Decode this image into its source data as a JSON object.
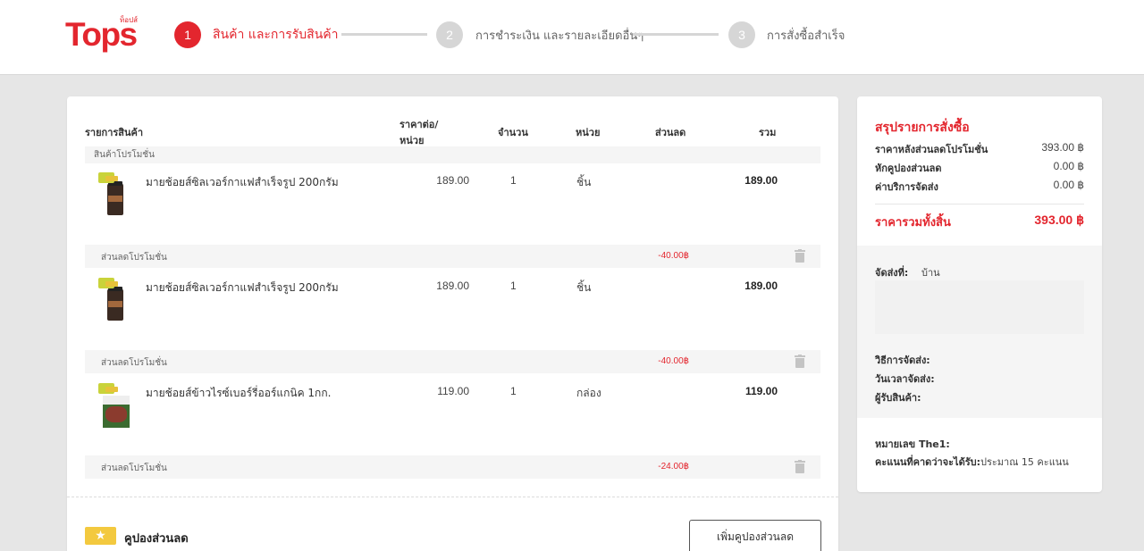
{
  "brand": {
    "logo_text": "Tops",
    "logo_small": "ท็อปส์",
    "accent": "#e3262e"
  },
  "steps": [
    {
      "number": "1",
      "label": "สินค้า และการรับสินค้า",
      "state": "active"
    },
    {
      "number": "2",
      "label": "การชำระเงิน และรายละเอียดอื่นๆ",
      "state": "inactive"
    },
    {
      "number": "3",
      "label": "การสั่งซื้อสำเร็จ",
      "state": "inactive"
    }
  ],
  "cart": {
    "headers": {
      "item": "รายการสินค้า",
      "price_line1": "ราคาต่อ/",
      "price_line2": "หน่วย",
      "qty": "จำนวน",
      "unit": "หน่วย",
      "discount": "ส่วนลด",
      "total": "รวม"
    },
    "promo_section_label": "สินค้าโปรโมชั่น",
    "items": [
      {
        "name": "มายช้อยส์ซิลเวอร์กาแฟสำเร็จรูป 200กรัม",
        "price": "189.00",
        "qty": "1",
        "unit": "ชิ้น",
        "total": "189.00",
        "image_icon": "coffee-jar-icon",
        "discount_label": "ส่วนลดโปรโมชั่น",
        "discount_amount": "-40.00฿"
      },
      {
        "name": "มายช้อยส์ซิลเวอร์กาแฟสำเร็จรูป 200กรัม",
        "price": "189.00",
        "qty": "1",
        "unit": "ชิ้น",
        "total": "189.00",
        "image_icon": "coffee-jar-icon",
        "discount_label": "ส่วนลดโปรโมชั่น",
        "discount_amount": "-40.00฿"
      },
      {
        "name": "มายช้อยส์ข้าวไรซ์เบอร์รี่ออร์แกนิค 1กก.",
        "price": "119.00",
        "qty": "1",
        "unit": "กล่อง",
        "total": "119.00",
        "image_icon": "rice-box-icon",
        "discount_label": "ส่วนลดโปรโมชั่น",
        "discount_amount": "-24.00฿"
      }
    ],
    "coupon_label": "คูปองส่วนลด",
    "coupon_button": "เพิ่มคูปองส่วนลด"
  },
  "summary": {
    "title": "สรุปรายการสั่งซื้อ",
    "rows": [
      {
        "label": "ราคาหลังส่วนลดโปรโมชั่น",
        "value": "393.00 ฿"
      },
      {
        "label": "หักคูปองส่วนลด",
        "value": "0.00 ฿"
      },
      {
        "label": "ค่าบริการจัดส่ง",
        "value": "0.00 ฿"
      }
    ],
    "grand_total_label": "ราคารวมทั้งสิ้น",
    "grand_total_value": "393.00 ฿",
    "ship_to_label": "จัดส่งที่:",
    "ship_to_value": "บ้าน",
    "delivery_method_label": "วิธีการจัดส่ง:",
    "delivery_time_label": "วันเวลาจัดส่ง:",
    "receiver_label": "ผู้รับสินค้า:",
    "the1_label": "หมายเลข The1:",
    "points_label": "คะแนนที่คาดว่าจะได้รับ:",
    "points_value": "ประมาณ 15 คะแนน"
  }
}
